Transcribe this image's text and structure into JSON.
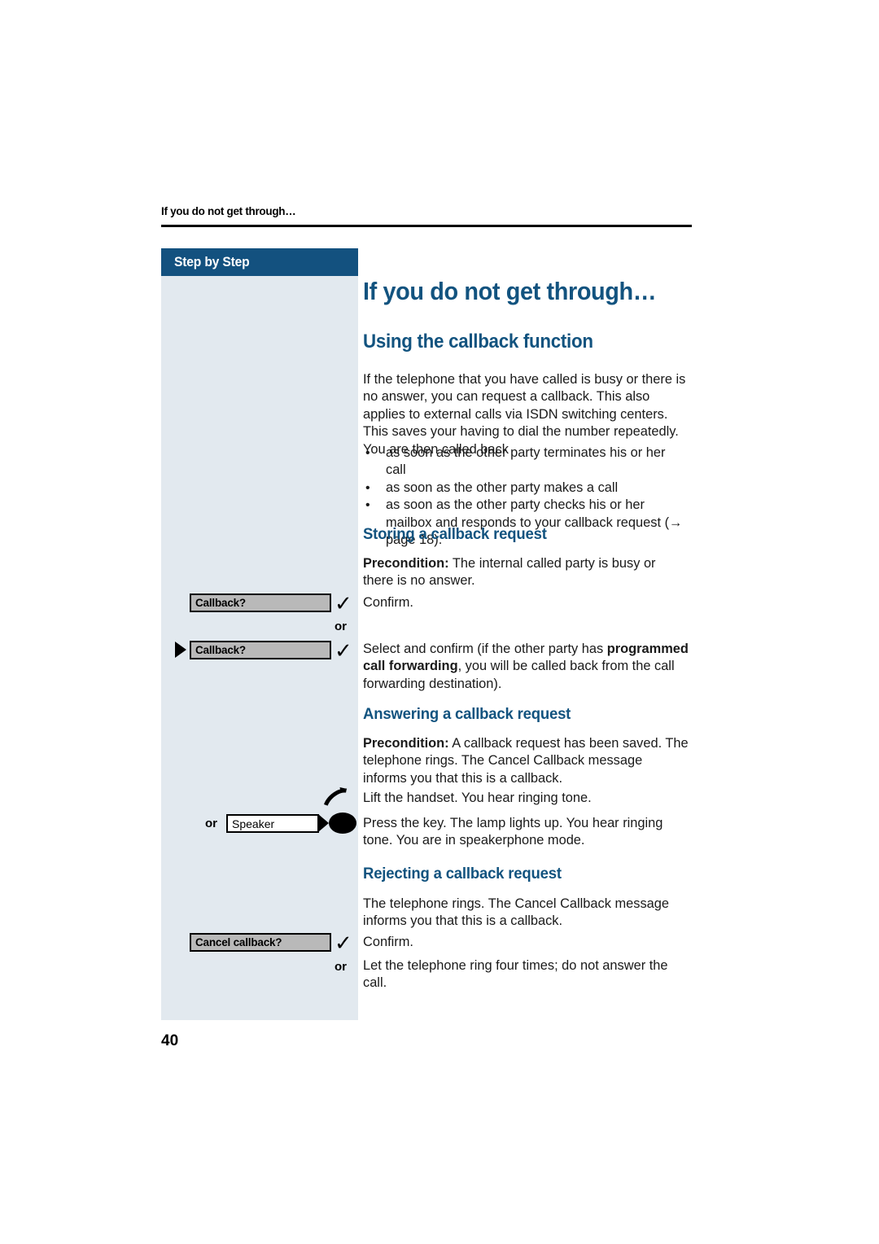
{
  "page": {
    "running_header": "If you do not get through…",
    "page_number": "40"
  },
  "sidebar": {
    "header_label": "Step by Step"
  },
  "content": {
    "chapter_title": "If you do not get through…",
    "section_title": "Using the callback function",
    "intro_paragraph": "If the telephone that you have called is busy or there is no answer, you can request a callback. This also applies to external calls via ISDN switching centers. This saves your having to dial the number repeatedly. You are then called back",
    "bullets": [
      "as soon as the other party terminates his or her call",
      "as soon as the other party makes a call",
      "as soon as the other party checks his or her mailbox and responds to your callback request (→ page 18)."
    ],
    "bullet_glyph": "•",
    "subsections": [
      {
        "title": "Storing a callback request",
        "precondition_label": "Precondition:",
        "precondition_text": " The internal called party is busy or there is no answer.",
        "step1_text": "Confirm.",
        "step2_text_a": "Select and confirm (if the other party has ",
        "step2_bold_a": "programmed",
        "step2_bold_b": "call forwarding",
        "step2_text_b": ", you will be called back from the call forwarding destination)."
      },
      {
        "title": "Answering a callback request",
        "precondition_label": "Precondition:",
        "precondition_text": " A callback request has been saved. The telephone rings. The Cancel Callback message informs you that this is a callback.",
        "step1_text": "Lift the handset. You hear ringing tone.",
        "step2_text": "Press the key. The lamp lights up. You hear ringing tone. You are in speakerphone mode."
      },
      {
        "title": "Rejecting a callback request",
        "intro_text": "The telephone rings. The Cancel Callback message informs you that this is a callback.",
        "step1_text": "Confirm.",
        "step2_text": "Let the telephone ring four times; do not answer the call."
      }
    ]
  },
  "widgets": {
    "softkey_callback_1": "Callback?",
    "softkey_callback_2": "Callback?",
    "softkey_cancel_callback": "Cancel callback?",
    "key_speaker_label": "Speaker",
    "or_label": "or",
    "checkmark_glyph": "✓"
  },
  "colors": {
    "heading_blue": "#12537f",
    "sidebar_header_blue": "#13517f",
    "sidebar_bg": "#e2e9ef",
    "softkey_fill": "#b9b9b9",
    "text_black": "#1a1a1a"
  }
}
